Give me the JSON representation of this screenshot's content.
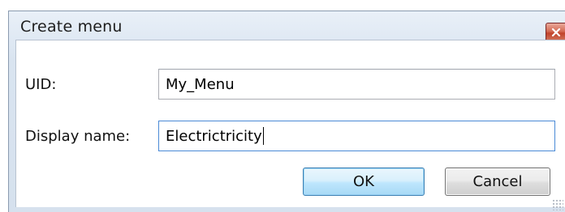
{
  "window": {
    "title": "Create menu"
  },
  "form": {
    "uid": {
      "label": "UID:",
      "value": "My_Menu"
    },
    "display_name": {
      "label": "Display name:",
      "value": "Electrictricity"
    }
  },
  "buttons": {
    "ok_label": "OK",
    "cancel_label": "Cancel"
  },
  "icons": {
    "close": "close-icon",
    "resize_grip": "resize-grip-icon"
  }
}
